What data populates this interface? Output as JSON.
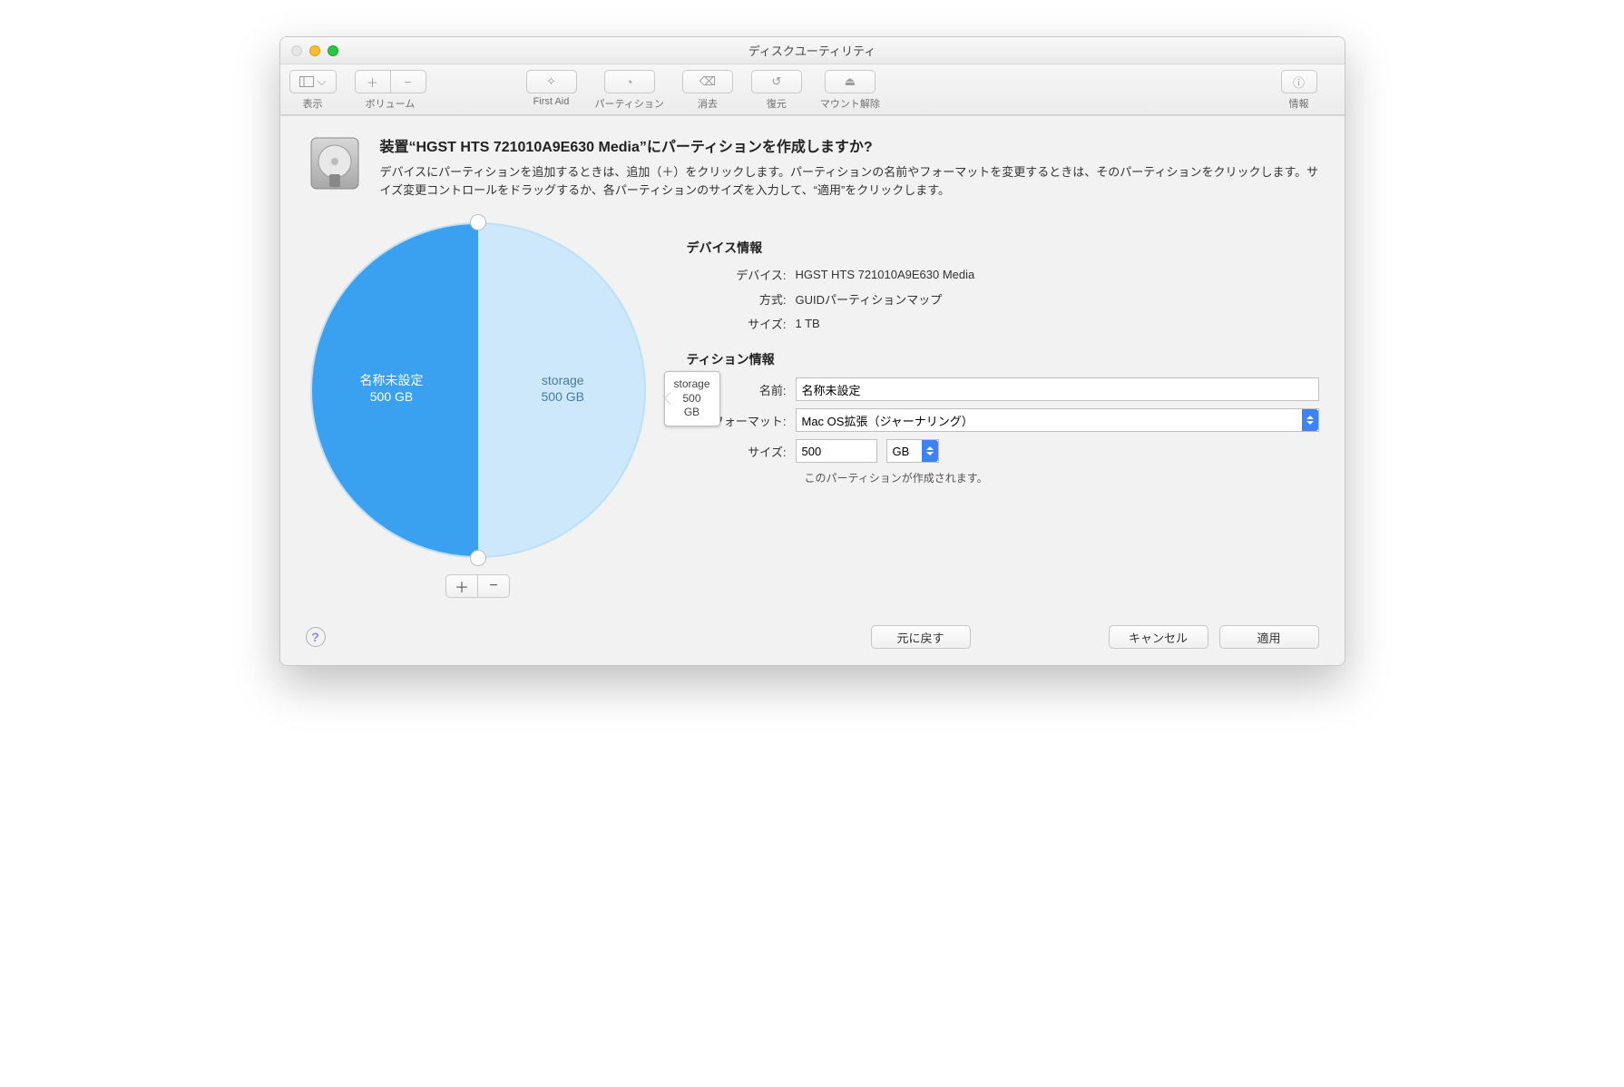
{
  "window": {
    "title": "ディスクユーティリティ"
  },
  "toolbar": {
    "view": "表示",
    "volume": "ボリューム",
    "firstaid": "First Aid",
    "partition": "パーティション",
    "erase": "消去",
    "restore": "復元",
    "unmount": "マウント解除",
    "info": "情報"
  },
  "sheet": {
    "title": "装置“HGST HTS 721010A9E630 Media”にパーティションを作成しますか?",
    "desc": "デバイスにパーティションを追加するときは、追加（＋）をクリックします。パーティションの名前やフォーマットを変更するときは、そのパーティションをクリックします。サイズ変更コントロールをドラッグするか、各パーティションのサイズを入力して、“適用”をクリックします。"
  },
  "pie": {
    "left": {
      "name": "名称未設定",
      "size": "500 GB"
    },
    "right": {
      "name": "storage",
      "size": "500 GB"
    }
  },
  "tooltip": {
    "name": "storage",
    "size": "500 GB"
  },
  "device_info": {
    "heading": "デバイス情報",
    "device_label": "デバイス:",
    "device_value": "HGST HTS 721010A9E630 Media",
    "scheme_label": "方式:",
    "scheme_value": "GUIDパーティションマップ",
    "size_label": "サイズ:",
    "size_value": "1 TB"
  },
  "partition_info": {
    "heading": "ティション情報",
    "name_label": "名前:",
    "name_value": "名称未設定",
    "format_label": "フォーマット:",
    "format_value": "Mac OS拡張（ジャーナリング）",
    "size_label": "サイズ:",
    "size_value": "500",
    "unit": "GB",
    "hint": "このパーティションが作成されます。"
  },
  "footer": {
    "revert": "元に戻す",
    "cancel": "キャンセル",
    "apply": "適用"
  },
  "chart_data": {
    "type": "pie",
    "title": "",
    "series": [
      {
        "name": "名称未設定",
        "value": 500,
        "unit": "GB",
        "color": "#3aa0f0"
      },
      {
        "name": "storage",
        "value": 500,
        "unit": "GB",
        "color": "#cce8fa"
      }
    ],
    "total": {
      "value": 1,
      "unit": "TB"
    }
  }
}
